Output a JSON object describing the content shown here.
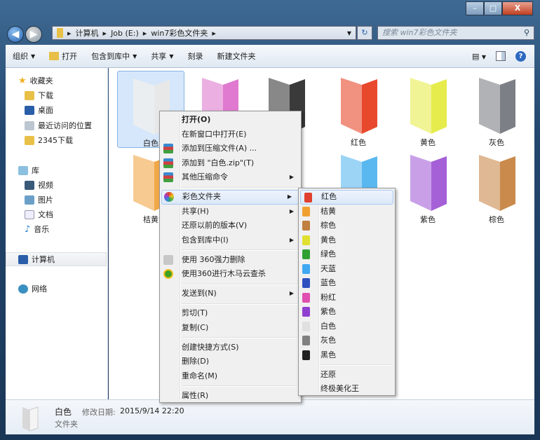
{
  "window": {
    "min": "–",
    "max": "□",
    "close": "X"
  },
  "address": {
    "crumbs": [
      "计算机",
      "Job (E:)",
      "win7彩色文件夹"
    ],
    "search_placeholder": "搜索 win7彩色文件夹"
  },
  "toolbar": {
    "organize": "组织",
    "open": "打开",
    "include_library": "包含到库中",
    "share": "共享",
    "burn": "刻录",
    "new_folder": "新建文件夹"
  },
  "nav": {
    "favorites": "收藏夹",
    "downloads": "下载",
    "desktop": "桌面",
    "recent": "最近访问的位置",
    "dl2345": "2345下载",
    "libraries": "库",
    "videos": "视频",
    "pictures": "图片",
    "documents": "文档",
    "music": "音乐",
    "computer": "计算机",
    "network": "网络"
  },
  "folders": [
    {
      "label": "白色",
      "color": "#e8e8e8"
    },
    {
      "label": "",
      "color": "#e07ad0"
    },
    {
      "label": "",
      "color": "#3a3a3a"
    },
    {
      "label": "红色",
      "color": "#e8482c"
    },
    {
      "label": "黄色",
      "color": "#e6ec4c"
    },
    {
      "label": "灰色",
      "color": "#7d7f86"
    },
    {
      "label": "桔黄",
      "color": "#f0a848"
    },
    {
      "label": "",
      "color": "#5ab8f0"
    },
    {
      "label": "紫色",
      "color": "#a560d8"
    },
    {
      "label": "棕色",
      "color": "#c98a4c"
    }
  ],
  "context_menu": {
    "open": "打开(O)",
    "open_new_window": "在新窗口中打开(E)",
    "add_archive": "添加到压缩文件(A) ...",
    "add_zip": "添加到 \"白色.zip\"(T)",
    "other_compress": "其他压缩命令",
    "color_folder": "彩色文件夹",
    "share": "共享(H)",
    "restore_prev": "还原以前的版本(V)",
    "include_library": "包含到库中(I)",
    "del_360": "使用 360强力删除",
    "scan_360": "使用360进行木马云查杀",
    "send_to": "发送到(N)",
    "cut": "剪切(T)",
    "copy": "复制(C)",
    "shortcut": "创建快捷方式(S)",
    "delete": "删除(D)",
    "rename": "重命名(M)",
    "properties": "属性(R)"
  },
  "color_submenu": {
    "colors": [
      {
        "label": "红色",
        "color": "#e04030"
      },
      {
        "label": "桔黄",
        "color": "#f0a030"
      },
      {
        "label": "棕色",
        "color": "#c08040"
      },
      {
        "label": "黄色",
        "color": "#e0e030"
      },
      {
        "label": "绿色",
        "color": "#30a030"
      },
      {
        "label": "天蓝",
        "color": "#40a8f0"
      },
      {
        "label": "蓝色",
        "color": "#3050c0"
      },
      {
        "label": "粉红",
        "color": "#e050b0"
      },
      {
        "label": "紫色",
        "color": "#9040d0"
      },
      {
        "label": "白色",
        "color": "#e0e0e0"
      },
      {
        "label": "灰色",
        "color": "#808080"
      },
      {
        "label": "黑色",
        "color": "#202020"
      }
    ],
    "restore": "还原",
    "beautify": "终极美化王"
  },
  "status": {
    "name": "白色",
    "modified_label": "修改日期:",
    "modified": "2015/9/14 22:20",
    "type": "文件夹"
  }
}
